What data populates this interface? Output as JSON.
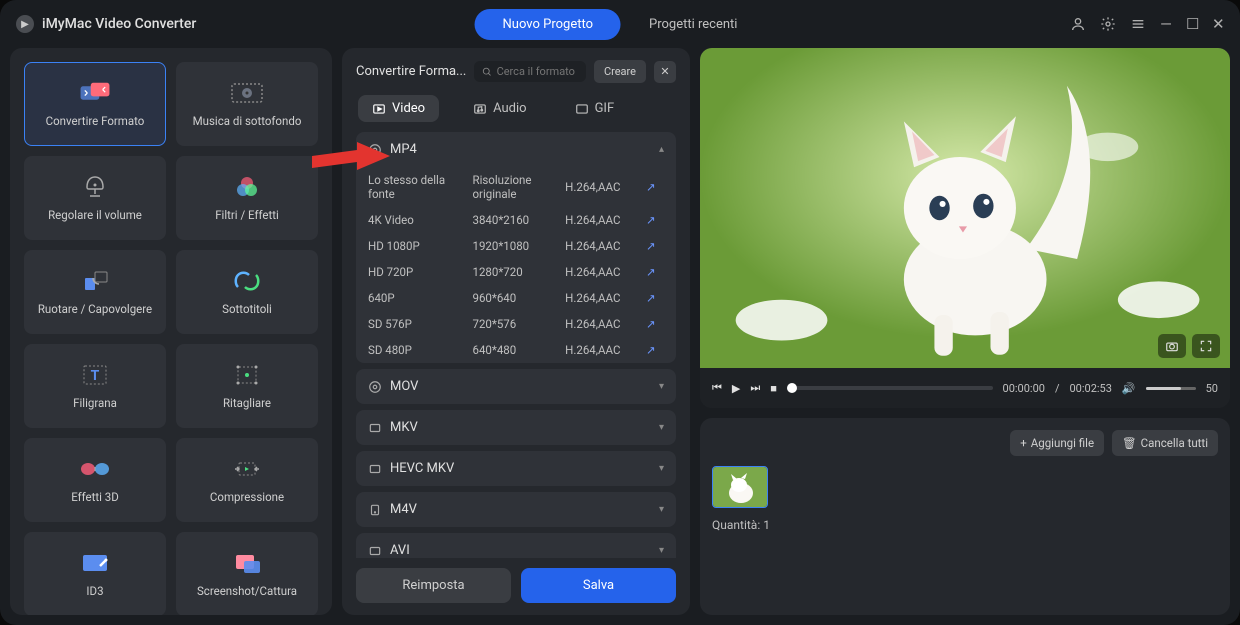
{
  "app": {
    "title": "iMyMac Video Converter"
  },
  "topTabs": {
    "new": "Nuovo Progetto",
    "recent": "Progetti recenti"
  },
  "tools": [
    {
      "label": "Convertire Formato"
    },
    {
      "label": "Musica di sottofondo"
    },
    {
      "label": "Regolare il volume"
    },
    {
      "label": "Filtri / Effetti"
    },
    {
      "label": "Ruotare / Capovolgere"
    },
    {
      "label": "Sottotitoli"
    },
    {
      "label": "Filigrana"
    },
    {
      "label": "Ritagliare"
    },
    {
      "label": "Effetti 3D"
    },
    {
      "label": "Compressione"
    },
    {
      "label": "ID3"
    },
    {
      "label": "Screenshot/Cattura"
    }
  ],
  "center": {
    "title": "Convertire Forma...",
    "searchPlaceholder": "Cerca il formato",
    "create": "Creare",
    "tabs": {
      "video": "Video",
      "audio": "Audio",
      "gif": "GIF"
    },
    "groups": {
      "mp4": "MP4",
      "mov": "MOV",
      "mkv": "MKV",
      "hevcmkv": "HEVC MKV",
      "m4v": "M4V",
      "avi": "AVI"
    },
    "presets": [
      {
        "name": "Lo stesso della fonte",
        "res": "Risoluzione originale",
        "codec": "H.264,AAC"
      },
      {
        "name": "4K Video",
        "res": "3840*2160",
        "codec": "H.264,AAC"
      },
      {
        "name": "HD 1080P",
        "res": "1920*1080",
        "codec": "H.264,AAC"
      },
      {
        "name": "HD 720P",
        "res": "1280*720",
        "codec": "H.264,AAC"
      },
      {
        "name": "640P",
        "res": "960*640",
        "codec": "H.264,AAC"
      },
      {
        "name": "SD 576P",
        "res": "720*576",
        "codec": "H.264,AAC"
      },
      {
        "name": "SD 480P",
        "res": "640*480",
        "codec": "H.264,AAC"
      }
    ],
    "reset": "Reimposta",
    "save": "Salva"
  },
  "player": {
    "current": "00:00:00",
    "total": "00:02:53",
    "volume": "50"
  },
  "filelist": {
    "add": "Aggiungi file",
    "clear": "Cancella tutti",
    "qtyLabel": "Quantità:",
    "qty": "1"
  }
}
